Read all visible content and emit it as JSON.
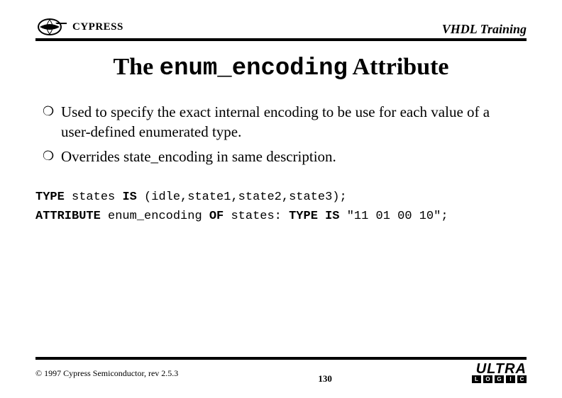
{
  "header": {
    "brand": "CYPRESS",
    "title": "VHDL Training"
  },
  "title": {
    "prefix": "The ",
    "code": "enum_encoding",
    "suffix": " Attribute"
  },
  "bullets": [
    "Used to specify the exact internal encoding to be use for each value of a user-defined enumerated type.",
    "Overrides state_encoding in same description."
  ],
  "code": {
    "line1_kw1": "TYPE",
    "line1_mid": " states ",
    "line1_kw2": "IS",
    "line1_end": " (idle,state1,state2,state3);",
    "line2_kw1": "ATTRIBUTE",
    "line2_mid1": " enum_encoding ",
    "line2_kw2": "OF",
    "line2_mid2": " states: ",
    "line2_kw3": "TYPE IS",
    "line2_end": " \"11 01 00 10\";"
  },
  "footer": {
    "copyright": "© 1997 Cypress Semiconductor, rev 2.5.3",
    "page": "130",
    "ultra": "ULTRA",
    "logic": [
      "L",
      "O",
      "G",
      "I",
      "C"
    ]
  }
}
